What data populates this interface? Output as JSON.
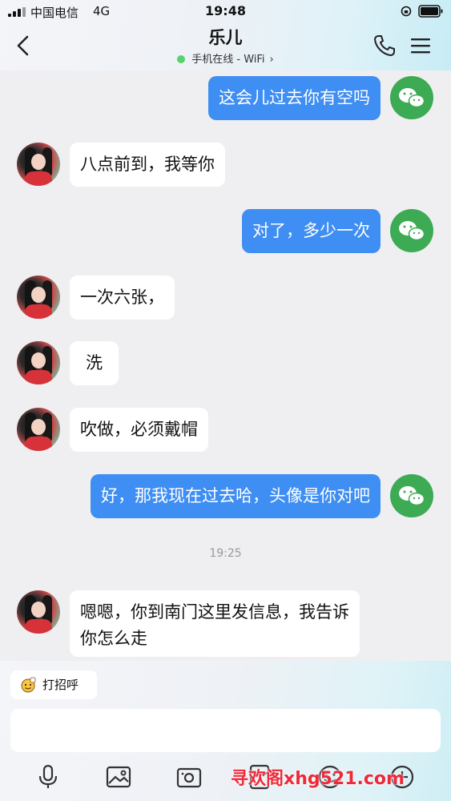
{
  "status_bar": {
    "carrier": "中国电信",
    "network": "4G",
    "time": "19:48"
  },
  "header": {
    "title": "乐儿",
    "presence": "手机在线 - WiFi",
    "presence_color": "#55d36d"
  },
  "messages": [
    {
      "side": "out",
      "text": "这会儿过去你有空吗"
    },
    {
      "side": "in",
      "text": "八点前到，我等你"
    },
    {
      "side": "out",
      "text": "对了，多少一次"
    },
    {
      "side": "in",
      "text": "一次六张，"
    },
    {
      "side": "in",
      "text": "洗"
    },
    {
      "side": "in",
      "text": "吹做，必须戴帽"
    },
    {
      "side": "out",
      "text": "好，那我现在过去哈，头像是你对吧"
    },
    {
      "side": "in",
      "text_line1": "嗯嗯，你到南门这里发信息，我告诉",
      "text_line2": "你怎么走"
    }
  ],
  "time_divider": "19:25",
  "composer": {
    "greet_label": "打招呼",
    "input_value": "",
    "tools": [
      "mic-icon",
      "image-icon",
      "camera-icon",
      "red-packet-icon",
      "emoji-icon",
      "plus-icon"
    ]
  },
  "watermark": "寻欢阁xhg521.com",
  "colors": {
    "out_bubble": "#3f8ef3",
    "in_bubble": "#ffffff",
    "wechat_avatar": "#3daa54",
    "background": "#efeff2"
  }
}
